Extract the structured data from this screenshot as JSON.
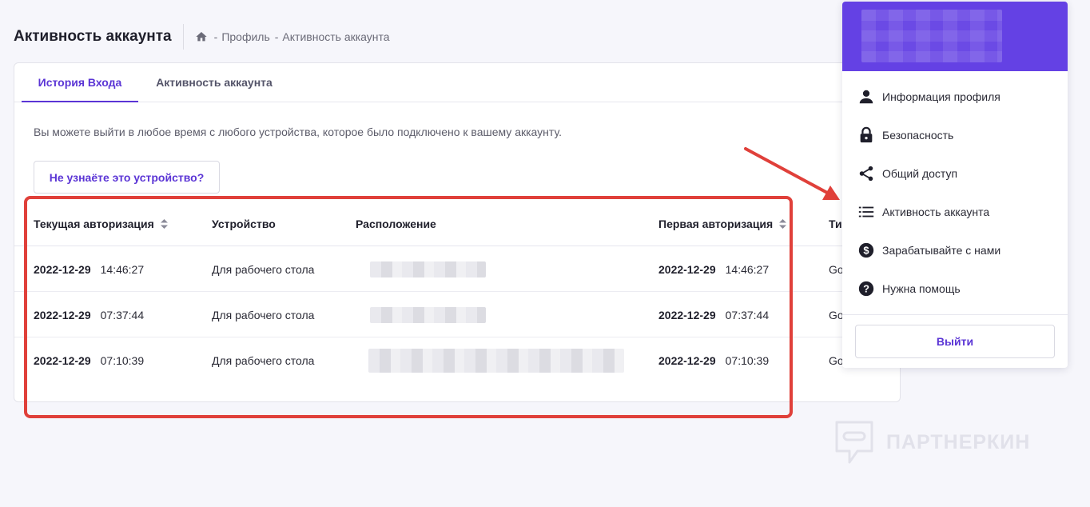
{
  "header": {
    "title": "Активность аккаунта",
    "breadcrumb": [
      "Профиль",
      "Активность аккаунта"
    ],
    "dash": "-"
  },
  "tabs": [
    {
      "label": "История Входа",
      "active": true
    },
    {
      "label": "Активность аккаунта",
      "active": false
    }
  ],
  "intro_text": "Вы можете выйти в любое время с любого устройства, которое было подключено к вашему аккаунту.",
  "unknown_device_button": "Не узнаёте это устройство?",
  "table": {
    "columns": [
      "Текущая авторизация",
      "Устройство",
      "Расположение",
      "Первая авторизация",
      "Ти"
    ],
    "rows": [
      {
        "current_date": "2022-12-29",
        "current_time": "14:46:27",
        "device": "Для рабочего стола",
        "location_hidden": true,
        "first_date": "2022-12-29",
        "first_time": "14:46:27",
        "type": "Go"
      },
      {
        "current_date": "2022-12-29",
        "current_time": "07:37:44",
        "device": "Для рабочего стола",
        "location_hidden": true,
        "first_date": "2022-12-29",
        "first_time": "07:37:44",
        "type": "Go"
      },
      {
        "current_date": "2022-12-29",
        "current_time": "07:10:39",
        "device": "Для рабочего стола",
        "location_hidden": true,
        "first_date": "2022-12-29",
        "first_time": "07:10:39",
        "type": "Go"
      }
    ]
  },
  "dropdown": {
    "items": [
      {
        "label": "Информация профиля",
        "icon": "person-icon"
      },
      {
        "label": "Безопасность",
        "icon": "lock-icon"
      },
      {
        "label": "Общий доступ",
        "icon": "share-icon"
      },
      {
        "label": "Активность аккаунта",
        "icon": "list-icon"
      },
      {
        "label": "Зарабатывайте с нами",
        "icon": "dollar-icon"
      },
      {
        "label": "Нужна помощь",
        "icon": "help-icon"
      }
    ],
    "logout_label": "Выйти"
  },
  "watermark": "ПАРТНЕРКИН",
  "colors": {
    "accent": "#5b35d5",
    "dropdown_header": "#6441e4",
    "highlight": "#e0403a"
  }
}
